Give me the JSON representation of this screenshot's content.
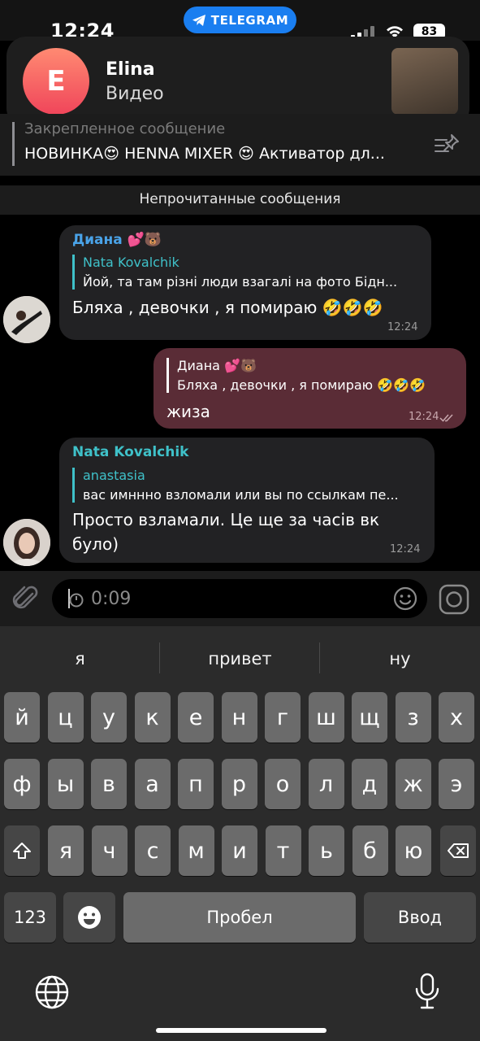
{
  "status": {
    "time": "12:24",
    "app_pill": "TELEGRAM",
    "battery": "83"
  },
  "notification": {
    "initial": "E",
    "name": "Elina",
    "subtitle": "Видео"
  },
  "pinned": {
    "title": "Закрепленное сообщение",
    "text": "НОВИНКА😍 HENNA MIXER 😍 Активатор дл..."
  },
  "unread_label": "Непрочитанные сообщения",
  "messages": [
    {
      "sender": "Диана 💕🐻",
      "reply_name": "Nata Kovalchik",
      "reply_text": "Йой, та там різні люди взагалі на фото  Бідн...",
      "text": "Бляха , девочки , я помираю 🤣🤣🤣",
      "time": "12:24"
    },
    {
      "reply_name": "Диана 💕🐻",
      "reply_text": "Бляха , девочки , я помираю 🤣🤣🤣",
      "text": "жиза",
      "time": "12:24"
    },
    {
      "sender": "Nata Kovalchik",
      "reply_name": "anastasia",
      "reply_text": "вас имннно взломали или вы по ссылкам пе...",
      "text_line1": "Просто взламали. Це ще за часів вк",
      "text_line2": "було)",
      "time": "12:24"
    }
  ],
  "input": {
    "recording_time": "0:09"
  },
  "keyboard": {
    "suggestions": [
      "я",
      "привет",
      "ну"
    ],
    "row1": [
      "й",
      "ц",
      "у",
      "к",
      "е",
      "н",
      "г",
      "ш",
      "щ",
      "з",
      "х"
    ],
    "row2": [
      "ф",
      "ы",
      "в",
      "а",
      "п",
      "р",
      "о",
      "л",
      "д",
      "ж",
      "э"
    ],
    "row3": [
      "я",
      "ч",
      "с",
      "м",
      "и",
      "т",
      "ь",
      "б",
      "ю"
    ],
    "numbers_label": "123",
    "space_label": "Пробел",
    "return_label": "Ввод"
  },
  "colors": {
    "accent": "#1a7ef0",
    "sender_diana": "#4aa3e8",
    "sender_nata": "#3fc1c9",
    "outgoing_bubble": "#5a2c36",
    "incoming_bubble": "#222224"
  }
}
